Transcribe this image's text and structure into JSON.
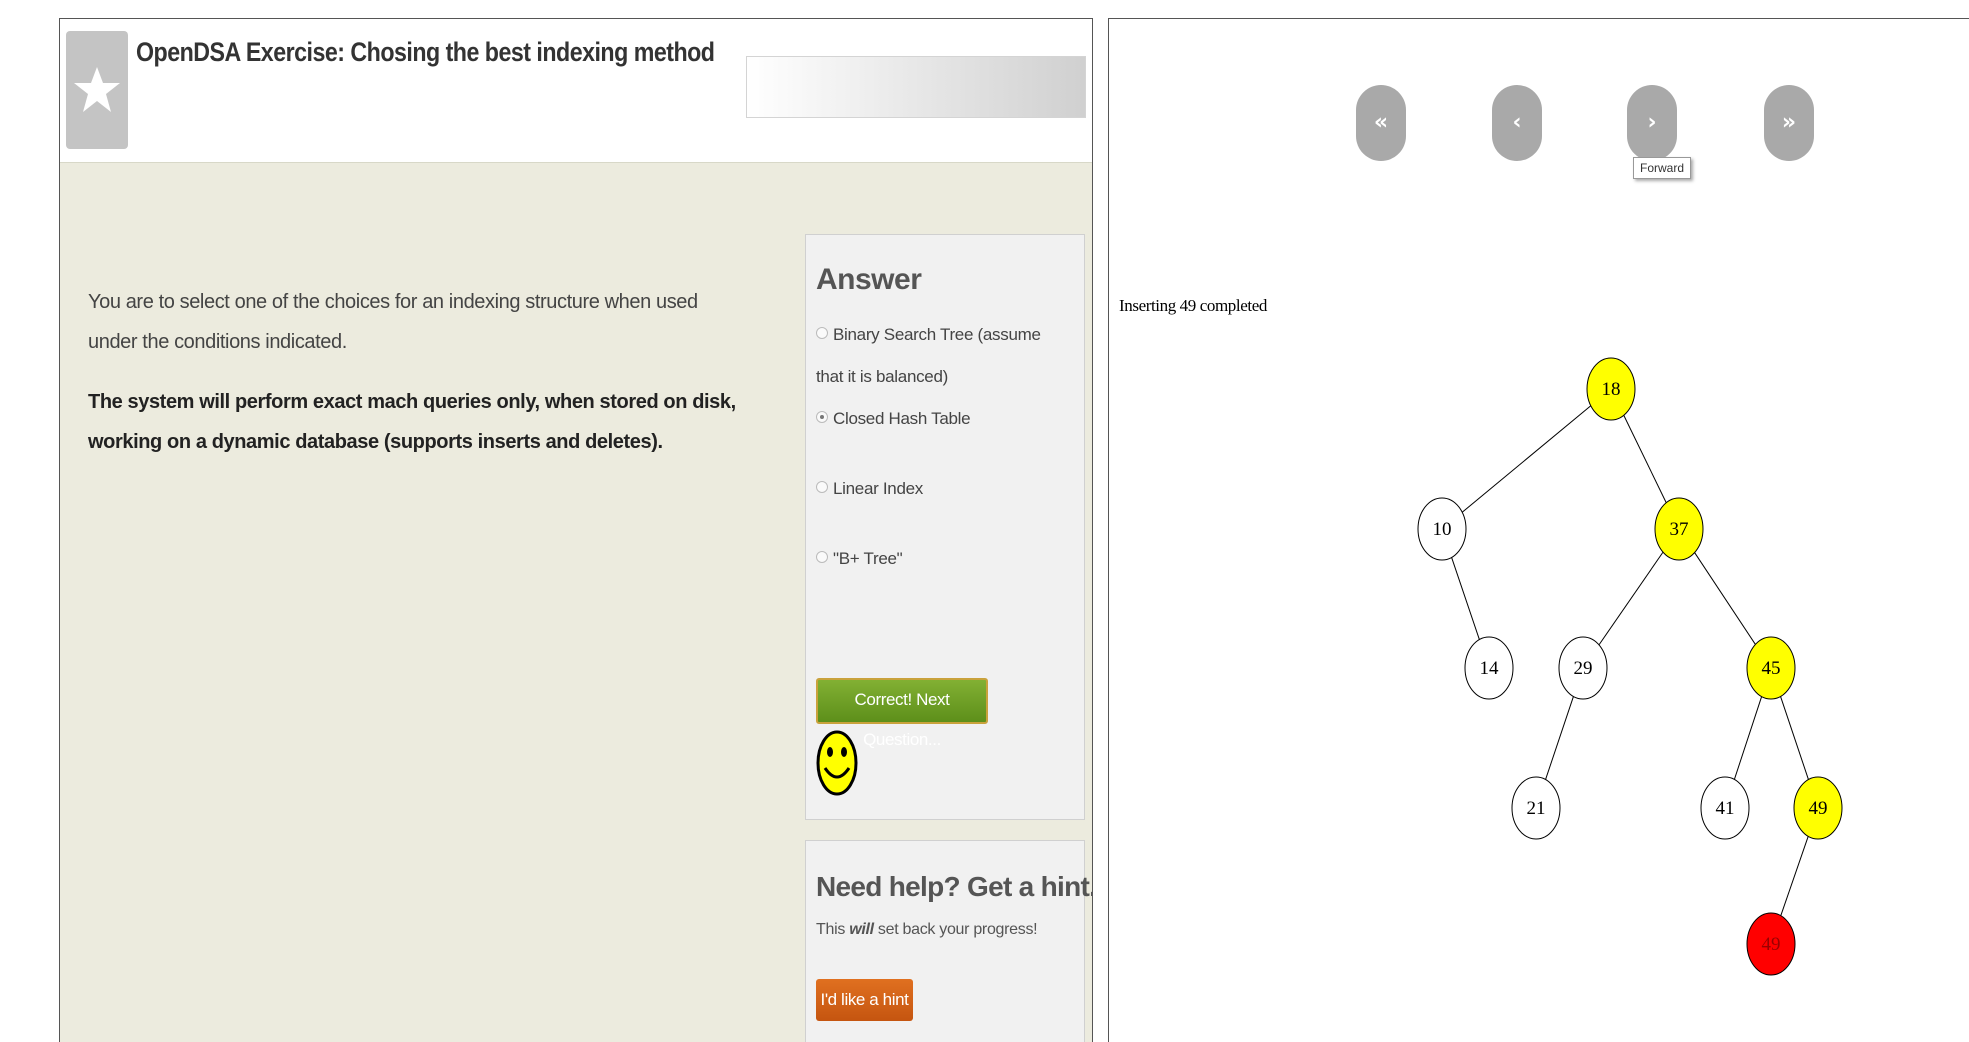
{
  "exercise": {
    "title": "OpenDSA Exercise: Chosing the best indexing method",
    "intro": "You are to select one of the choices for an indexing structure when used under the conditions indicated.",
    "condition": "The system will perform exact mach queries only, when stored on disk, working on a dynamic database (supports inserts and deletes)."
  },
  "answer": {
    "heading": "Answer",
    "choices": [
      {
        "label": "Binary Search Tree (assume that it is balanced)",
        "selected": false
      },
      {
        "label": "Closed Hash Table",
        "selected": true
      },
      {
        "label": "Linear Index",
        "selected": false
      },
      {
        "label": "\"B+ Tree\"",
        "selected": false
      }
    ],
    "check_button_label": "Correct! Next Question...",
    "feedback_icon": "smiley-icon"
  },
  "hint": {
    "heading": "Need help? Get a hint.",
    "warning_pre": "This ",
    "warning_emph": "will",
    "warning_post": " set back your progress!",
    "button_label": "I'd like a hint"
  },
  "visualization": {
    "nav": {
      "first": "«",
      "back": "‹",
      "forward": "›",
      "last": "»",
      "tooltip": "Forward"
    },
    "status": "Inserting 49 completed",
    "colors": {
      "highlight": "#ffff00",
      "new_node": "#ff0000",
      "normal": "#ffffff"
    },
    "tree": {
      "nodes": [
        {
          "id": "n18",
          "label": "18",
          "state": "highlight"
        },
        {
          "id": "n10",
          "label": "10",
          "state": "normal"
        },
        {
          "id": "n37",
          "label": "37",
          "state": "highlight"
        },
        {
          "id": "n14",
          "label": "14",
          "state": "normal"
        },
        {
          "id": "n29",
          "label": "29",
          "state": "normal"
        },
        {
          "id": "n45",
          "label": "45",
          "state": "highlight"
        },
        {
          "id": "n21",
          "label": "21",
          "state": "normal"
        },
        {
          "id": "n41",
          "label": "41",
          "state": "normal"
        },
        {
          "id": "n49a",
          "label": "49",
          "state": "highlight"
        },
        {
          "id": "n49b",
          "label": "49",
          "state": "new_node"
        }
      ],
      "edges": [
        [
          "n18",
          "n10"
        ],
        [
          "n18",
          "n37"
        ],
        [
          "n10",
          "n14"
        ],
        [
          "n37",
          "n29"
        ],
        [
          "n37",
          "n45"
        ],
        [
          "n29",
          "n21"
        ],
        [
          "n45",
          "n41"
        ],
        [
          "n45",
          "n49a"
        ],
        [
          "n49a",
          "n49b"
        ]
      ]
    }
  }
}
